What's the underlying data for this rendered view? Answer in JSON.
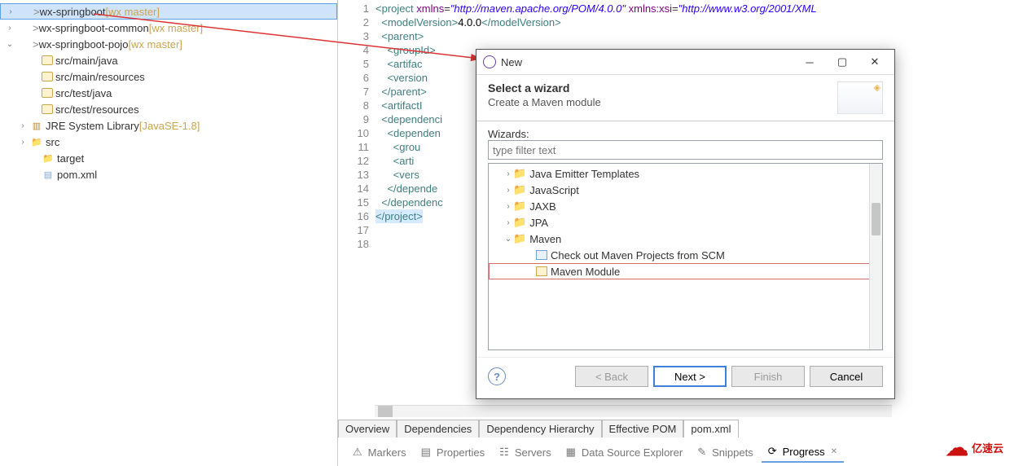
{
  "explorer": {
    "items": [
      {
        "tw": "›",
        "icon": "ic-proj",
        "pre": "> ",
        "label": "wx-springboot",
        "deco": "  [wx master]",
        "indent": 6,
        "sel": true
      },
      {
        "tw": "›",
        "icon": "ic-proj",
        "pre": "> ",
        "label": "wx-springboot-common",
        "deco": "  [wx master]",
        "indent": 6
      },
      {
        "tw": "⌄",
        "icon": "ic-proj",
        "pre": "> ",
        "label": "wx-springboot-pojo",
        "deco": "  [wx master]",
        "indent": 6
      },
      {
        "tw": "",
        "icon": "ic-jar",
        "pre": "",
        "label": "src/main/java",
        "deco": "",
        "indent": 36
      },
      {
        "tw": "",
        "icon": "ic-jar",
        "pre": "",
        "label": "src/main/resources",
        "deco": "",
        "indent": 36
      },
      {
        "tw": "",
        "icon": "ic-jar",
        "pre": "",
        "label": "src/test/java",
        "deco": "",
        "indent": 36
      },
      {
        "tw": "",
        "icon": "ic-jar",
        "pre": "",
        "label": "src/test/resources",
        "deco": "",
        "indent": 36
      },
      {
        "tw": "›",
        "icon": "ic-pkg",
        "pre": "",
        "label": "JRE System Library ",
        "deco": "[JavaSE-1.8]",
        "indent": 22
      },
      {
        "tw": "›",
        "icon": "ic-folder",
        "pre": "",
        "label": "src",
        "deco": "",
        "indent": 22
      },
      {
        "tw": "",
        "icon": "ic-folder",
        "pre": "",
        "label": "target",
        "deco": "",
        "indent": 36
      },
      {
        "tw": "",
        "icon": "ic-file",
        "pre": "",
        "label": "pom.xml",
        "deco": "",
        "indent": 36
      }
    ]
  },
  "editor": {
    "lines": [
      {
        "n": "1",
        "html": "<span class='tg'>&lt;project</span> <span class='at'>xmlns</span>=<span class='st'>\"http://maven.apache.org/POM/4.0.0\"</span> <span class='at'>xmlns:xsi</span>=<span class='st'>\"http://www.w3.org/2001/XML</span>"
      },
      {
        "n": "2",
        "html": "  <span class='tg'>&lt;modelVersion&gt;</span><span class='tx'>4.0.0</span><span class='tg'>&lt;/modelVersion&gt;</span>"
      },
      {
        "n": "3",
        "html": "  <span class='tg'>&lt;parent&gt;</span>"
      },
      {
        "n": "4",
        "html": "    <span class='tg'>&lt;groupId&gt;</span>"
      },
      {
        "n": "5",
        "html": "    <span class='tg'>&lt;artifac</span>"
      },
      {
        "n": "6",
        "html": "    <span class='tg'>&lt;version</span>"
      },
      {
        "n": "7",
        "html": "  <span class='tg'>&lt;/parent&gt;</span>"
      },
      {
        "n": "8",
        "html": "  <span class='tg'>&lt;artifactI</span>"
      },
      {
        "n": "9",
        "html": ""
      },
      {
        "n": "10",
        "html": "  <span class='tg'>&lt;dependenci</span>"
      },
      {
        "n": "11",
        "html": "    <span class='tg'>&lt;dependen</span>"
      },
      {
        "n": "12",
        "html": "      <span class='tg'>&lt;grou</span>"
      },
      {
        "n": "13",
        "html": "      <span class='tg'>&lt;arti</span>"
      },
      {
        "n": "14",
        "html": "      <span class='tg'>&lt;vers</span>"
      },
      {
        "n": "15",
        "html": "    <span class='tg'>&lt;/depende</span>"
      },
      {
        "n": "16",
        "html": "  <span class='tg'>&lt;/dependenc</span>"
      },
      {
        "n": "17",
        "html": ""
      },
      {
        "n": "18",
        "html": "<span class='cur'><span class='tg'>&lt;/project&gt;</span></span>"
      }
    ]
  },
  "tabs": [
    "Overview",
    "Dependencies",
    "Dependency Hierarchy",
    "Effective POM",
    "pom.xml"
  ],
  "activeTab": 4,
  "views": [
    {
      "ic": "⚠",
      "label": "Markers"
    },
    {
      "ic": "▤",
      "label": "Properties"
    },
    {
      "ic": "☷",
      "label": "Servers"
    },
    {
      "ic": "▦",
      "label": "Data Source Explorer"
    },
    {
      "ic": "✎",
      "label": "Snippets"
    },
    {
      "ic": "⟳",
      "label": "Progress",
      "active": true,
      "close": "✕"
    }
  ],
  "dialog": {
    "title": "New",
    "heading": "Select a wizard",
    "sub": "Create a Maven module",
    "wizardsLabel": "Wizards:",
    "filterPlaceholder": "type filter text",
    "filterValue": "",
    "tree": [
      {
        "tw": "›",
        "ic": "fold",
        "label": "Java Emitter Templates",
        "i": 18
      },
      {
        "tw": "›",
        "ic": "fold",
        "label": "JavaScript",
        "i": 18
      },
      {
        "tw": "›",
        "ic": "fold",
        "label": "JAXB",
        "i": 18
      },
      {
        "tw": "›",
        "ic": "fold",
        "label": "JPA",
        "i": 18
      },
      {
        "tw": "⌄",
        "ic": "fold",
        "label": "Maven",
        "i": 18
      },
      {
        "tw": "",
        "ic": "mico",
        "label": "Check out Maven Projects from SCM",
        "i": 46
      },
      {
        "tw": "",
        "ic": "mmico",
        "label": "Maven Module",
        "i": 46,
        "sel": true
      }
    ],
    "buttons": {
      "back": "< Back",
      "next": "Next >",
      "finish": "Finish",
      "cancel": "Cancel"
    }
  },
  "logo": "亿速云"
}
